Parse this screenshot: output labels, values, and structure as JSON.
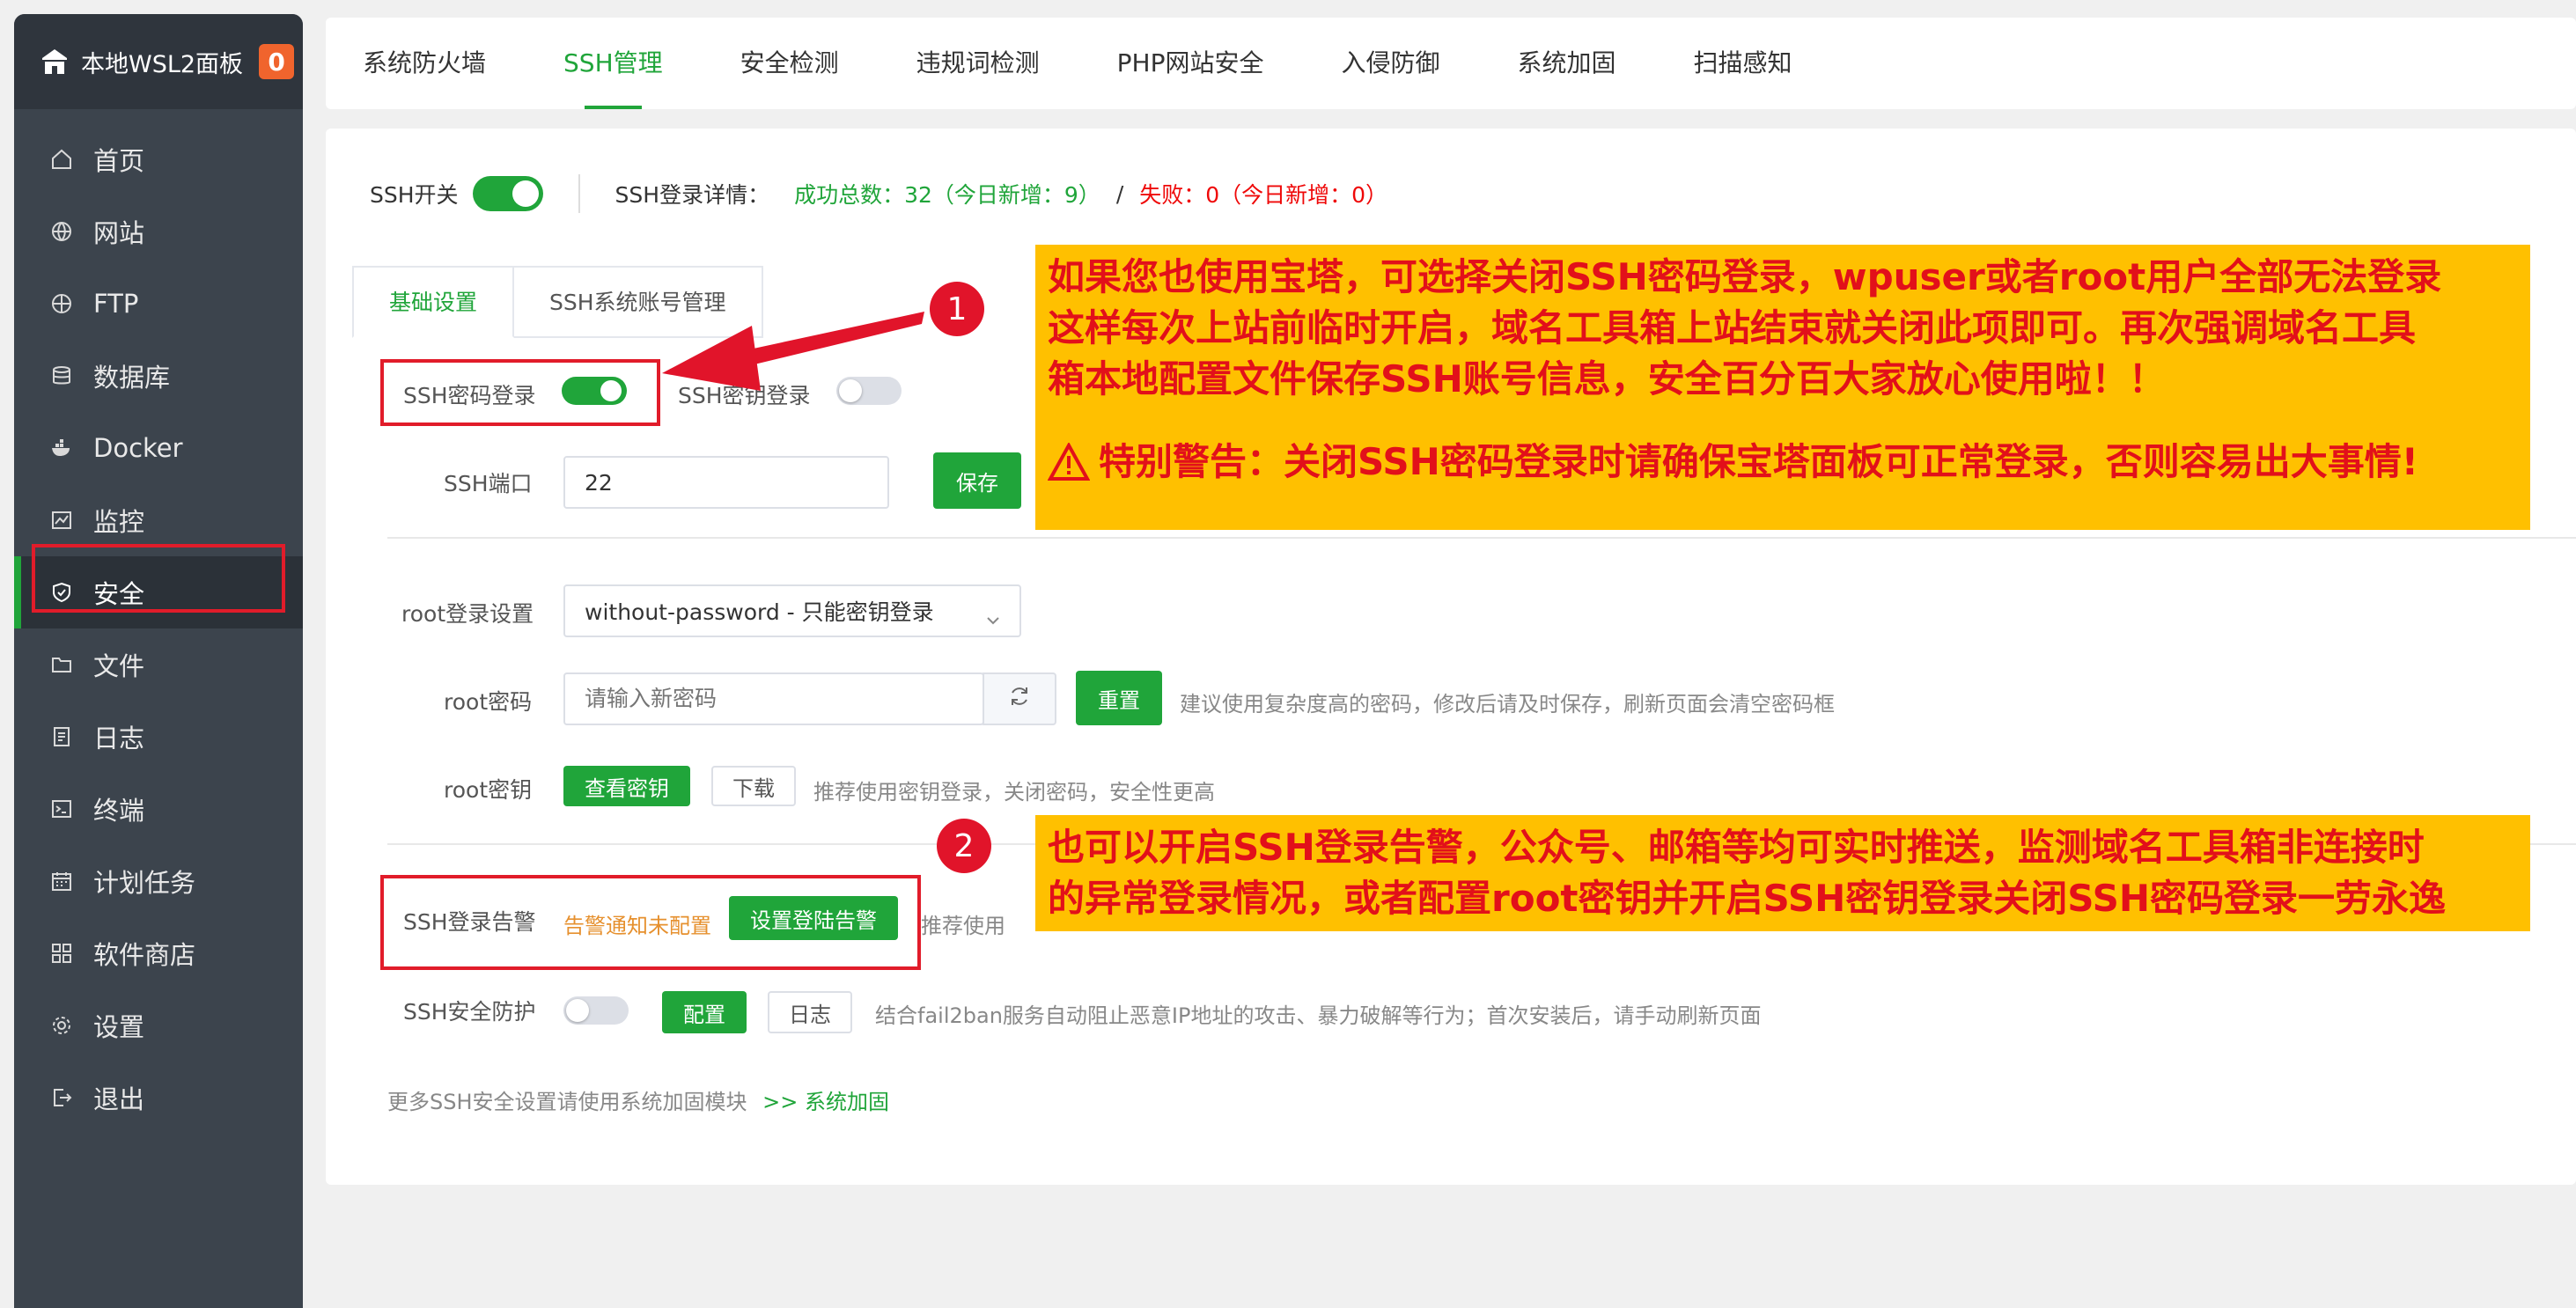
{
  "sidebar": {
    "brand": "本地WSL2面板",
    "badge": "0",
    "items": [
      {
        "label": "首页",
        "icon": "home-icon"
      },
      {
        "label": "网站",
        "icon": "globe-icon"
      },
      {
        "label": "FTP",
        "icon": "ftp-icon"
      },
      {
        "label": "数据库",
        "icon": "database-icon"
      },
      {
        "label": "Docker",
        "icon": "docker-icon"
      },
      {
        "label": "监控",
        "icon": "monitor-icon"
      },
      {
        "label": "安全",
        "icon": "shield-icon"
      },
      {
        "label": "文件",
        "icon": "folder-icon"
      },
      {
        "label": "日志",
        "icon": "log-icon"
      },
      {
        "label": "终端",
        "icon": "terminal-icon"
      },
      {
        "label": "计划任务",
        "icon": "calendar-icon"
      },
      {
        "label": "软件商店",
        "icon": "apps-icon"
      },
      {
        "label": "设置",
        "icon": "gear-icon"
      },
      {
        "label": "退出",
        "icon": "logout-icon"
      }
    ]
  },
  "tabs": [
    "系统防火墙",
    "SSH管理",
    "安全检测",
    "违规词检测",
    "PHP网站安全",
    "入侵防御",
    "系统加固",
    "扫描感知"
  ],
  "ssh": {
    "switch_label": "SSH开关",
    "detail_label": "SSH登录详情：",
    "success": "成功总数：32（今日新增：9）",
    "divider": "/",
    "fail": "失败：0（今日新增：0）"
  },
  "subtabs": [
    "基础设置",
    "SSH系统账号管理"
  ],
  "form": {
    "pwd_login_label": "SSH密码登录",
    "key_login_label": "SSH密钥登录",
    "port_label": "SSH端口",
    "port_value": "22",
    "save_btn": "保存",
    "root_login_label": "root登录设置",
    "root_login_value": "without-password - 只能密钥登录",
    "root_pwd_label": "root密码",
    "root_pwd_placeholder": "请输入新密码",
    "reset_btn": "重置",
    "root_pwd_hint": "建议使用复杂度高的密码，修改后请及时保存，刷新页面会清空密码框",
    "root_key_label": "root密钥",
    "view_key_btn": "查看密钥",
    "download_btn": "下载",
    "root_key_hint": "推荐使用密钥登录，关闭密码，安全性更高",
    "alert_label": "SSH登录告警",
    "alert_status": "告警通知未配置",
    "alert_btn": "设置登陆告警",
    "alert_hint": "推荐使用",
    "protect_label": "SSH安全防护",
    "config_btn": "配置",
    "log_btn": "日志",
    "protect_hint": "结合fail2ban服务自动阻止恶意IP地址的攻击、暴力破解等行为；首次安装后，请手动刷新页面",
    "more_text": "更多SSH安全设置请使用系统加固模块",
    "more_arrow": ">>",
    "more_link": "系统加固"
  },
  "annotations": {
    "num1": "1",
    "num2": "2",
    "note1_l1": "如果您也使用宝塔，可选择关闭SSH密码登录，wpuser或者root用户全部无法登录",
    "note1_l2": "这样每次上站前临时开启，域名工具箱上站结束就关闭此项即可。再次强调域名工具",
    "note1_l3": "箱本地配置文件保存SSH账号信息，安全百分百大家放心使用啦！！",
    "note1_l4": "特别警告：关闭SSH密码登录时请确保宝塔面板可正常登录，否则容易出大事情!",
    "note2_l1": "也可以开启SSH登录告警，公众号、邮箱等均可实时推送，监测域名工具箱非连接时",
    "note2_l2": "的异常登录情况，或者配置root密钥并开启SSH密钥登录关闭SSH密码登录一劳永逸"
  },
  "colors": {
    "accent": "#20a53a",
    "sidebar": "#3c444d",
    "warn_red": "#e11c2a",
    "note_bg": "#ffc000"
  }
}
